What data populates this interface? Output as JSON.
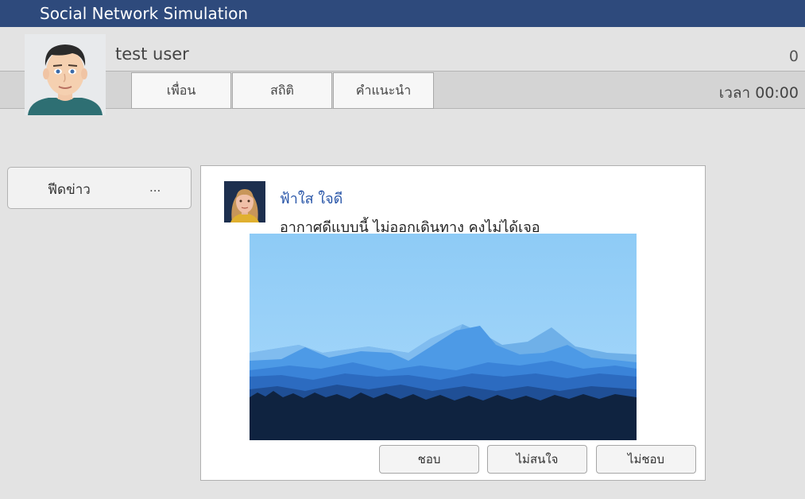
{
  "app": {
    "title": "Social Network Simulation"
  },
  "user": {
    "name": "test user",
    "counter": "0"
  },
  "tabs": [
    {
      "label": "เพื่อน"
    },
    {
      "label": "สถิติ"
    },
    {
      "label": "คำแนะนำ"
    }
  ],
  "timer": "เวลา 00:00",
  "sidebar": {
    "feed_label": "ฟีดข่าว",
    "more_label": "..."
  },
  "post": {
    "author": "ฟ้าใส ใจดี",
    "text": "อากาศดีแบบนี้ ไม่ออกเดินทาง คงไม่ได้เจอ",
    "actions": [
      {
        "label": "ชอบ"
      },
      {
        "label": "ไม่สนใจ"
      },
      {
        "label": "ไม่ชอบ"
      }
    ]
  },
  "colors": {
    "titlebar": "#2e4a7c",
    "author": "#2855a8",
    "background": "#e3e3e3"
  },
  "icons": {
    "user_avatar": "avatar-male-cartoon",
    "post_avatar": "avatar-female-cartoon",
    "post_image": "mountain-landscape"
  }
}
